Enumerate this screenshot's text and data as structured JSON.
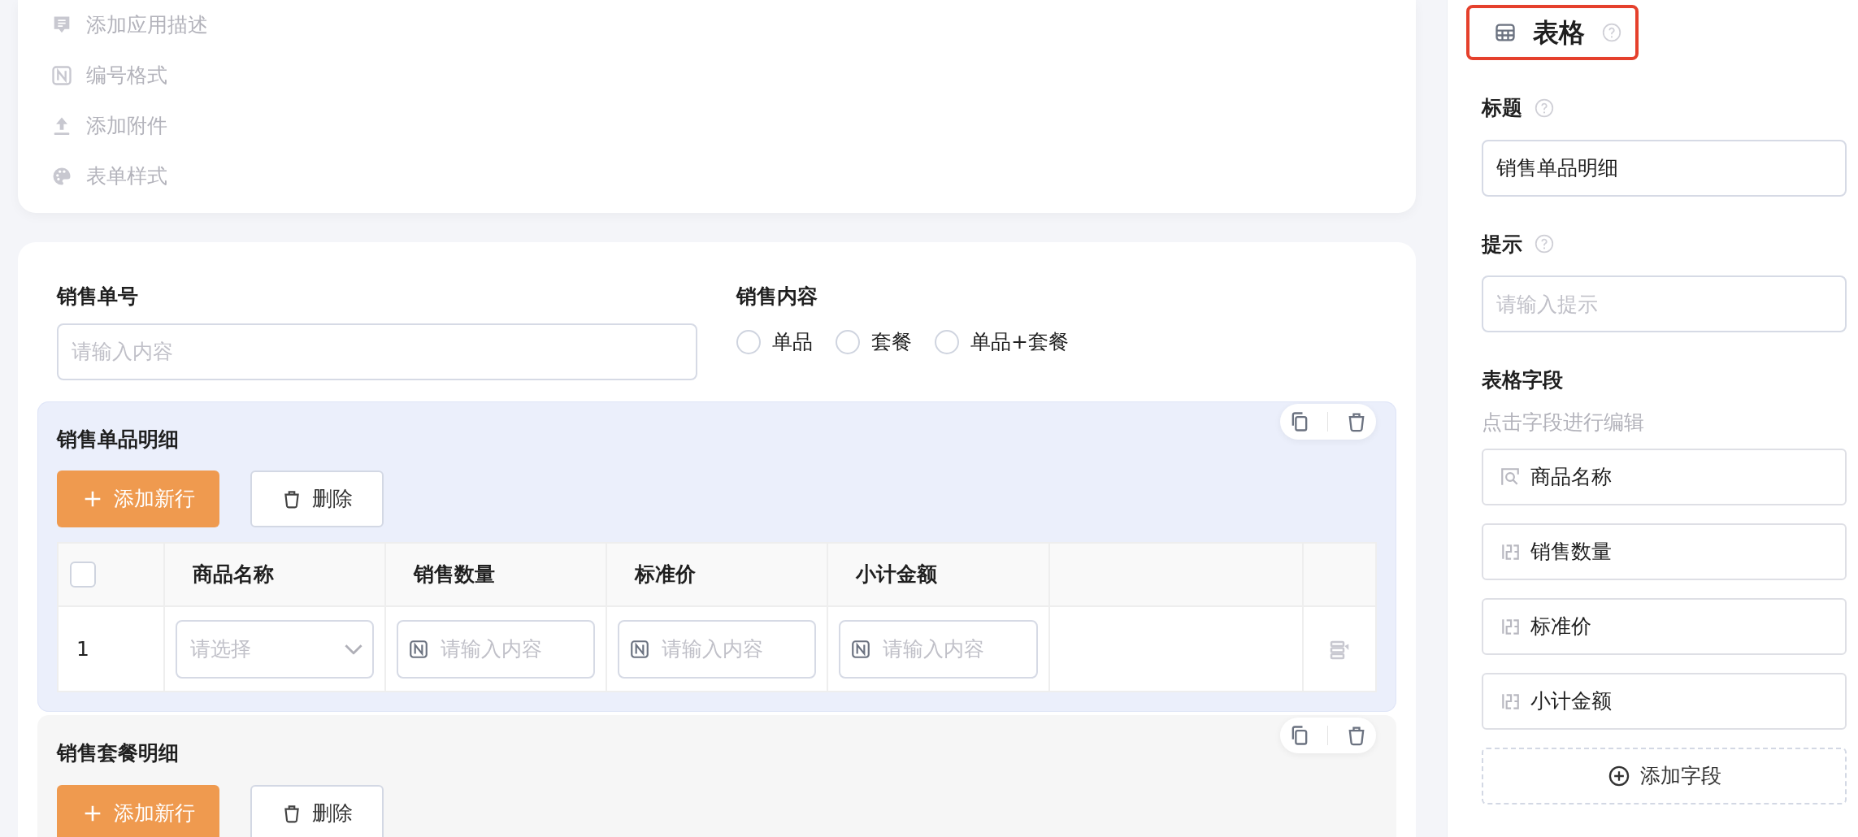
{
  "settings_menu": [
    {
      "kind": "description",
      "label": "添加应用描述"
    },
    {
      "kind": "numbering",
      "label": "编号格式"
    },
    {
      "kind": "attachment",
      "label": "添加附件"
    },
    {
      "kind": "style",
      "label": "表单样式"
    }
  ],
  "form": {
    "fields": [
      {
        "kind": "text",
        "label": "销售单号",
        "placeholder": "请输入内容"
      },
      {
        "kind": "radio",
        "label": "销售内容",
        "options": [
          {
            "label": "单品",
            "selected": false
          },
          {
            "label": "套餐",
            "selected": false
          },
          {
            "label": "单品+套餐",
            "selected": false
          }
        ]
      }
    ]
  },
  "subtables": [
    {
      "title": "销售单品明细",
      "selected": true,
      "add_button": "添加新行",
      "delete_button": "删除",
      "header_checkbox": {
        "checked": false
      },
      "columns": [
        "商品名称",
        "销售数量",
        "标准价",
        "小计金额"
      ],
      "rows": [
        {
          "index": "1",
          "cells": [
            {
              "kind": "select",
              "placeholder": "请选择"
            },
            {
              "kind": "number",
              "placeholder": "请输入内容"
            },
            {
              "kind": "number",
              "placeholder": "请输入内容"
            },
            {
              "kind": "number",
              "placeholder": "请输入内容"
            }
          ]
        }
      ]
    },
    {
      "title": "销售套餐明细",
      "selected": false,
      "add_button": "添加新行",
      "delete_button": "删除"
    }
  ],
  "properties_panel": {
    "title": "表格",
    "highlighted": true,
    "fields": [
      {
        "label": "标题",
        "value": "销售单品明细"
      },
      {
        "label": "提示",
        "placeholder": "请输入提示"
      }
    ],
    "table_fields": {
      "title": "表格字段",
      "hint": "点击字段进行编辑",
      "items": [
        {
          "kind": "lookup",
          "label": "商品名称"
        },
        {
          "kind": "number",
          "label": "销售数量"
        },
        {
          "kind": "number",
          "label": "标准价"
        },
        {
          "kind": "number",
          "label": "小计金额"
        }
      ],
      "add_button": "添加字段"
    }
  }
}
